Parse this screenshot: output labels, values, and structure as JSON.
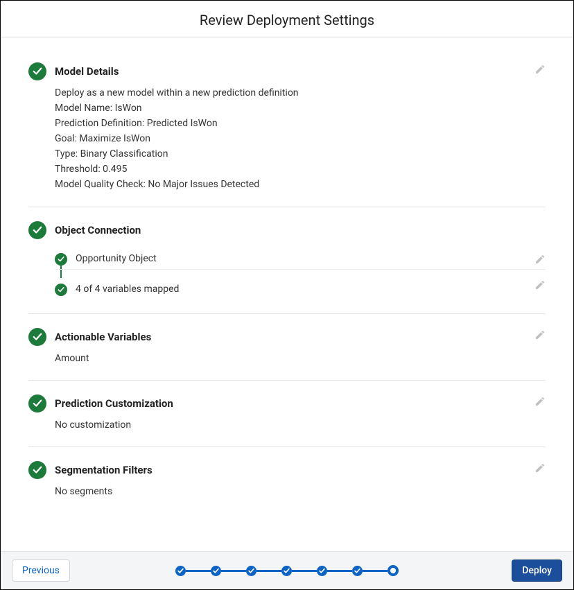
{
  "header": {
    "title": "Review Deployment Settings"
  },
  "sections": {
    "model_details": {
      "title": "Model Details",
      "lines": [
        "Deploy as a new model within a new prediction definition",
        "Model Name: IsWon",
        "Prediction Definition: Predicted IsWon",
        "Goal: Maximize IsWon",
        "Type: Binary Classification",
        "Threshold: 0.495",
        "Model Quality Check: No Major Issues Detected"
      ]
    },
    "object_connection": {
      "title": "Object Connection",
      "rows": [
        {
          "label": "Opportunity Object"
        },
        {
          "label": "4 of 4 variables mapped"
        }
      ]
    },
    "actionable_variables": {
      "title": "Actionable Variables",
      "body": "Amount"
    },
    "prediction_customization": {
      "title": "Prediction Customization",
      "body": "No customization"
    },
    "segmentation_filters": {
      "title": "Segmentation Filters",
      "body": "No segments"
    }
  },
  "footer": {
    "previous_label": "Previous",
    "deploy_label": "Deploy",
    "steps": [
      {
        "state": "done"
      },
      {
        "state": "done"
      },
      {
        "state": "done"
      },
      {
        "state": "done"
      },
      {
        "state": "done"
      },
      {
        "state": "done"
      },
      {
        "state": "current"
      }
    ]
  },
  "colors": {
    "check_green": "#1c7b3b",
    "brand_blue": "#0b63c6",
    "deploy_blue": "#1b4e9b"
  }
}
